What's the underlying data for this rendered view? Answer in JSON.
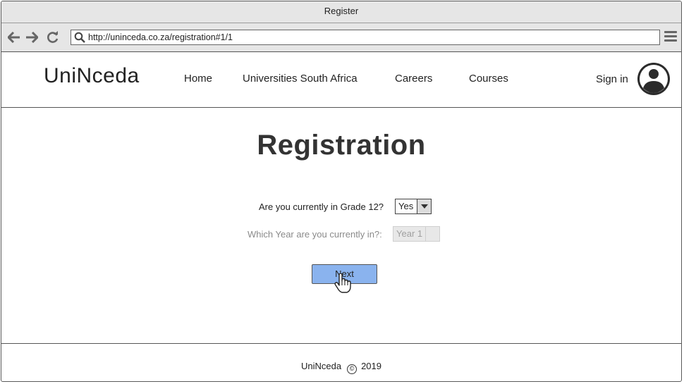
{
  "window": {
    "title": "Register"
  },
  "browser": {
    "url": "http://uninceda.co.za/registration#1/1",
    "icons": {
      "back": "arrow-left-icon",
      "forward": "arrow-right-icon",
      "reload": "reload-icon",
      "search": "search-icon",
      "menu": "hamburger-menu-icon"
    }
  },
  "header": {
    "logo": "UniNceda",
    "nav": [
      {
        "label": "Home"
      },
      {
        "label": "Universities South Africa"
      },
      {
        "label": "Careers"
      },
      {
        "label": "Courses"
      }
    ],
    "signin_label": "Sign in",
    "avatar_icon": "user-avatar-icon"
  },
  "main": {
    "title": "Registration",
    "grade_question": "Are you currently in Grade 12?",
    "grade_value": "Yes",
    "year_question": "Which Year are you currently in?:",
    "year_value": "Year 1",
    "year_disabled": true,
    "next_label": "Next",
    "cursor_icon": "hand-pointer-icon"
  },
  "footer": {
    "brand": "UniNceda",
    "copyright_symbol": "©",
    "year": "2019"
  },
  "colors": {
    "button_accent": "#8ab3ee",
    "chrome_bg": "#e6e6e6",
    "disabled_text": "#a0a0a0"
  }
}
